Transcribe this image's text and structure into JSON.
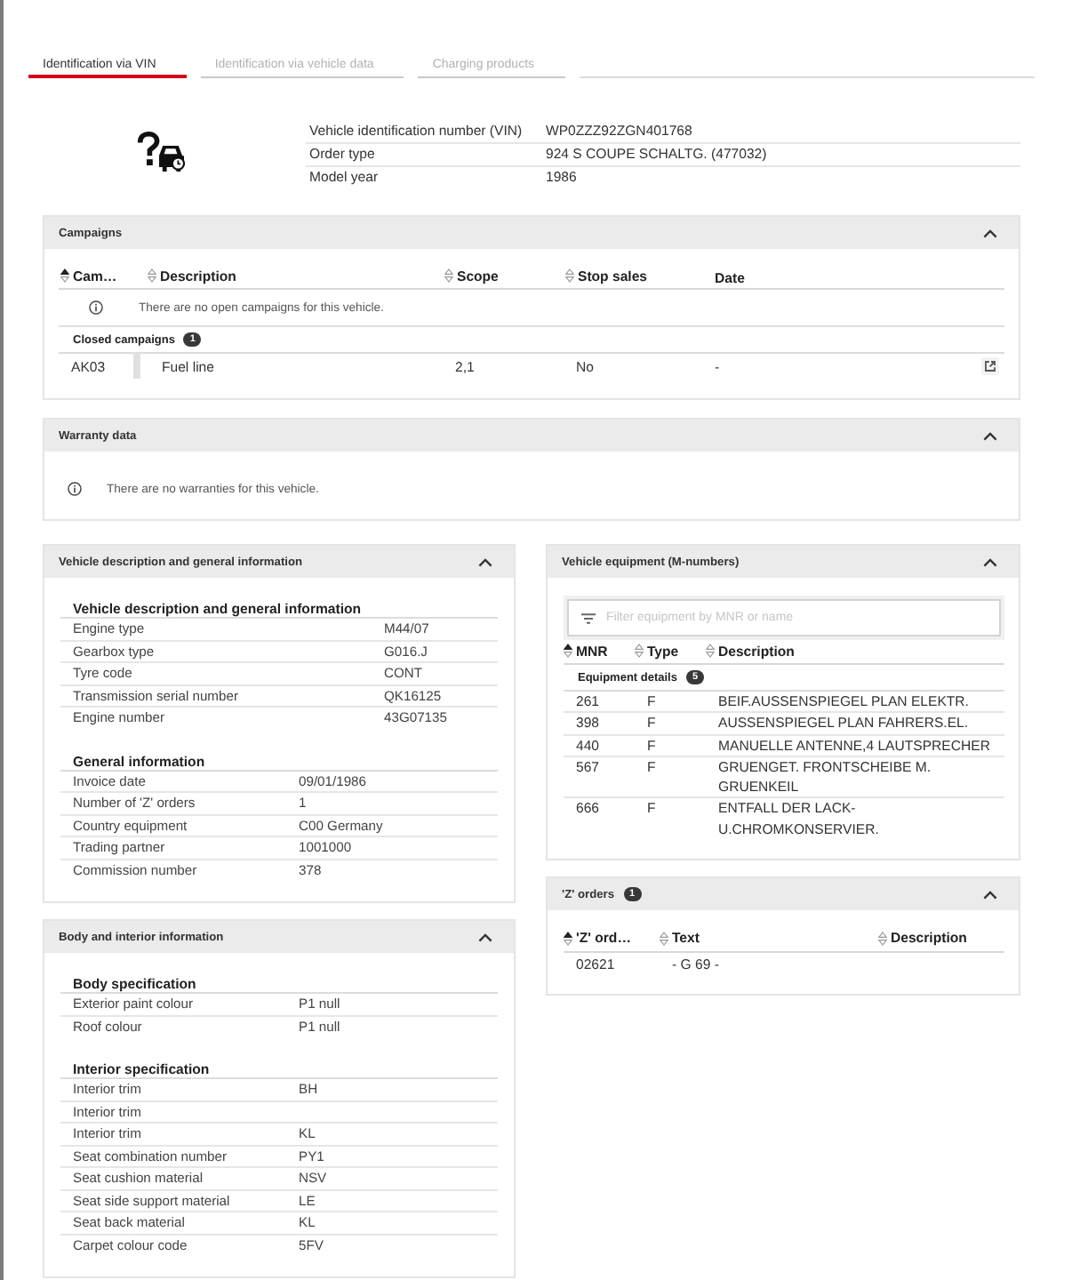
{
  "tabs": [
    {
      "label": "Identification via VIN",
      "selected": true
    },
    {
      "label": "Identification via vehicle data",
      "selected": false
    },
    {
      "label": "Charging products",
      "selected": false
    }
  ],
  "vehicle": {
    "fields": [
      {
        "label": "Vehicle identification number (VIN)",
        "value": "WP0ZZZ92ZGN401768"
      },
      {
        "label": "Order type",
        "value": "924 S COUPE SCHALTG. (477032)"
      },
      {
        "label": "Model year",
        "value": "1986"
      }
    ]
  },
  "campaigns": {
    "title": "Campaigns",
    "expanded": true,
    "columns": [
      {
        "label": "Cam…",
        "sortable": true,
        "sorted": true
      },
      {
        "label": "Description",
        "sortable": true,
        "sorted": false
      },
      {
        "label": "Scope",
        "sortable": true,
        "sorted": false
      },
      {
        "label": "Stop sales",
        "sortable": true,
        "sorted": false
      },
      {
        "label": "Date",
        "sortable": false
      }
    ],
    "notice": "There are no open campaigns for this vehicle.",
    "groups": [
      {
        "title": "Closed campaigns",
        "count": "1",
        "rows": [
          {
            "cells": [
              "AK03",
              "Fuel line",
              "2,1",
              "No",
              "-"
            ]
          }
        ]
      }
    ]
  },
  "warranty": {
    "title": "Warranty data",
    "expanded": true,
    "notice": "There are no warranties for this vehicle."
  },
  "vehicle_description": {
    "title": "Vehicle description and general information",
    "expanded": true,
    "sections": [
      {
        "heading": "Vehicle description and general information",
        "rows": [
          {
            "label": "Engine type",
            "value": "M44/07"
          },
          {
            "label": "Gearbox type",
            "value": "G016.J"
          },
          {
            "label": "Tyre code",
            "value": "CONT"
          },
          {
            "label": "Transmission serial number",
            "value": "QK16125"
          },
          {
            "label": "Engine number",
            "value": "43G07135"
          }
        ]
      },
      {
        "heading": "General information",
        "rows": [
          {
            "label": "Invoice date",
            "value": "09/01/1986"
          },
          {
            "label": "Number of 'Z' orders",
            "value": "1"
          },
          {
            "label": "Country equipment",
            "value": "C00 Germany"
          },
          {
            "label": "Trading partner",
            "value": "1001000"
          },
          {
            "label": "Commission number",
            "value": "378"
          }
        ]
      }
    ]
  },
  "body_interior": {
    "title": "Body and interior information",
    "expanded": true,
    "sections": [
      {
        "heading": "Body specification",
        "rows": [
          {
            "label": "Exterior paint colour",
            "value": "P1 null"
          },
          {
            "label": "Roof colour",
            "value": "P1 null"
          }
        ]
      },
      {
        "heading": "Interior specification",
        "rows": [
          {
            "label": "Interior trim",
            "value": "BH"
          },
          {
            "label": "Interior trim"
          },
          {
            "label": "Interior trim",
            "value": "KL"
          },
          {
            "label": "Seat combination number",
            "value": "PY1"
          },
          {
            "label": "Seat cushion material",
            "value": "NSV"
          },
          {
            "label": "Seat side support material",
            "value": "LE"
          },
          {
            "label": "Seat back material",
            "value": "KL"
          },
          {
            "label": "Carpet colour code",
            "value": "5FV"
          }
        ]
      }
    ]
  },
  "equipment": {
    "title": "Vehicle equipment (M-numbers)",
    "expanded": true,
    "filter": {
      "placeholder": "Filter equipment by MNR or name"
    },
    "columns": [
      {
        "label": "MNR",
        "sortable": true,
        "sorted": true
      },
      {
        "label": "Type",
        "sortable": true,
        "sorted": false
      },
      {
        "label": "Description",
        "sortable": true,
        "sorted": false
      }
    ],
    "groups": [
      {
        "title": "Equipment details",
        "count": "5",
        "rows": [
          {
            "cells": [
              "261",
              "F",
              "BEIF.AUSSENSPIEGEL PLAN ELEKTR."
            ]
          },
          {
            "cells": [
              "398",
              "F",
              "AUSSENSPIEGEL PLAN FAHRERS.EL."
            ]
          },
          {
            "cells": [
              "440",
              "F",
              "MANUELLE ANTENNE,4 LAUTSPRECHER"
            ]
          },
          {
            "cells": [
              "567",
              "F",
              "GRUENGET. FRONTSCHEIBE M. GRUENKEIL"
            ]
          },
          {
            "cells": [
              "666",
              "F",
              "ENTFALL DER LACK-U.CHROMKONSERVIER."
            ]
          }
        ]
      }
    ]
  },
  "z_orders": {
    "title": "'Z' orders",
    "count": "1",
    "expanded": true,
    "columns": [
      {
        "label": "'Z' ord…",
        "sortable": true,
        "sorted": true
      },
      {
        "label": "Text",
        "sortable": true,
        "sorted": false
      },
      {
        "label": "Description",
        "sortable": true,
        "sorted": false
      }
    ],
    "rows": [
      {
        "cells": [
          "02621",
          "- G 69 -"
        ]
      }
    ]
  }
}
